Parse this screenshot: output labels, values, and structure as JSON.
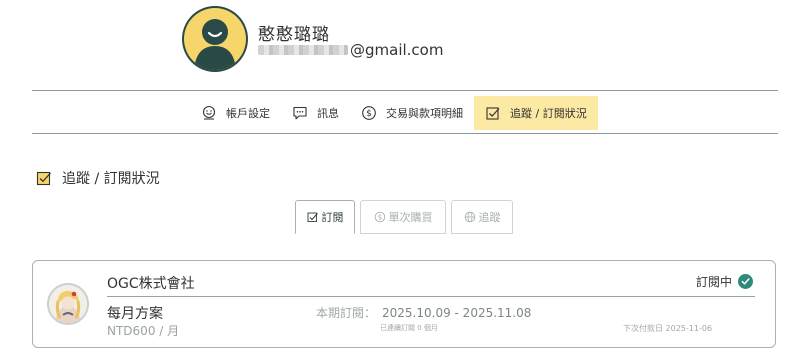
{
  "profile": {
    "name": "憨憨璐璐",
    "email_suffix": "@gmail.com"
  },
  "nav": {
    "items": [
      {
        "label": "帳戶設定",
        "icon": "account-face-icon"
      },
      {
        "label": "訊息",
        "icon": "message-bubble-icon"
      },
      {
        "label": "交易與款項明細",
        "icon": "dollar-circle-icon"
      },
      {
        "label": "追蹤 / 訂閱狀況",
        "icon": "checkbox-icon",
        "active": true
      }
    ]
  },
  "section": {
    "title": "追蹤 / 訂閱狀況"
  },
  "tabs": [
    {
      "label": "訂閱",
      "icon": "checkbox-icon",
      "active": true
    },
    {
      "label": "單次購買",
      "icon": "dollar-circle-icon",
      "active": false
    },
    {
      "label": "追蹤",
      "icon": "globe-icon",
      "active": false
    }
  ],
  "subscription": {
    "company": "OGC株式會社",
    "status": "訂閱中",
    "plan": "每月方案",
    "price": "NTD600 / 月",
    "period_label": "本期訂閱：",
    "period_value": "2025.10.09 - 2025.11.08",
    "consecutive": "已連續訂閱 0 個月",
    "next_payment": "下次付款日 2025-11-06"
  },
  "colors": {
    "accent_yellow": "#fbe9a4",
    "avatar_yellow": "#f6d66b",
    "dark_teal": "#2a4a48",
    "status_green": "#2f8a7b"
  }
}
